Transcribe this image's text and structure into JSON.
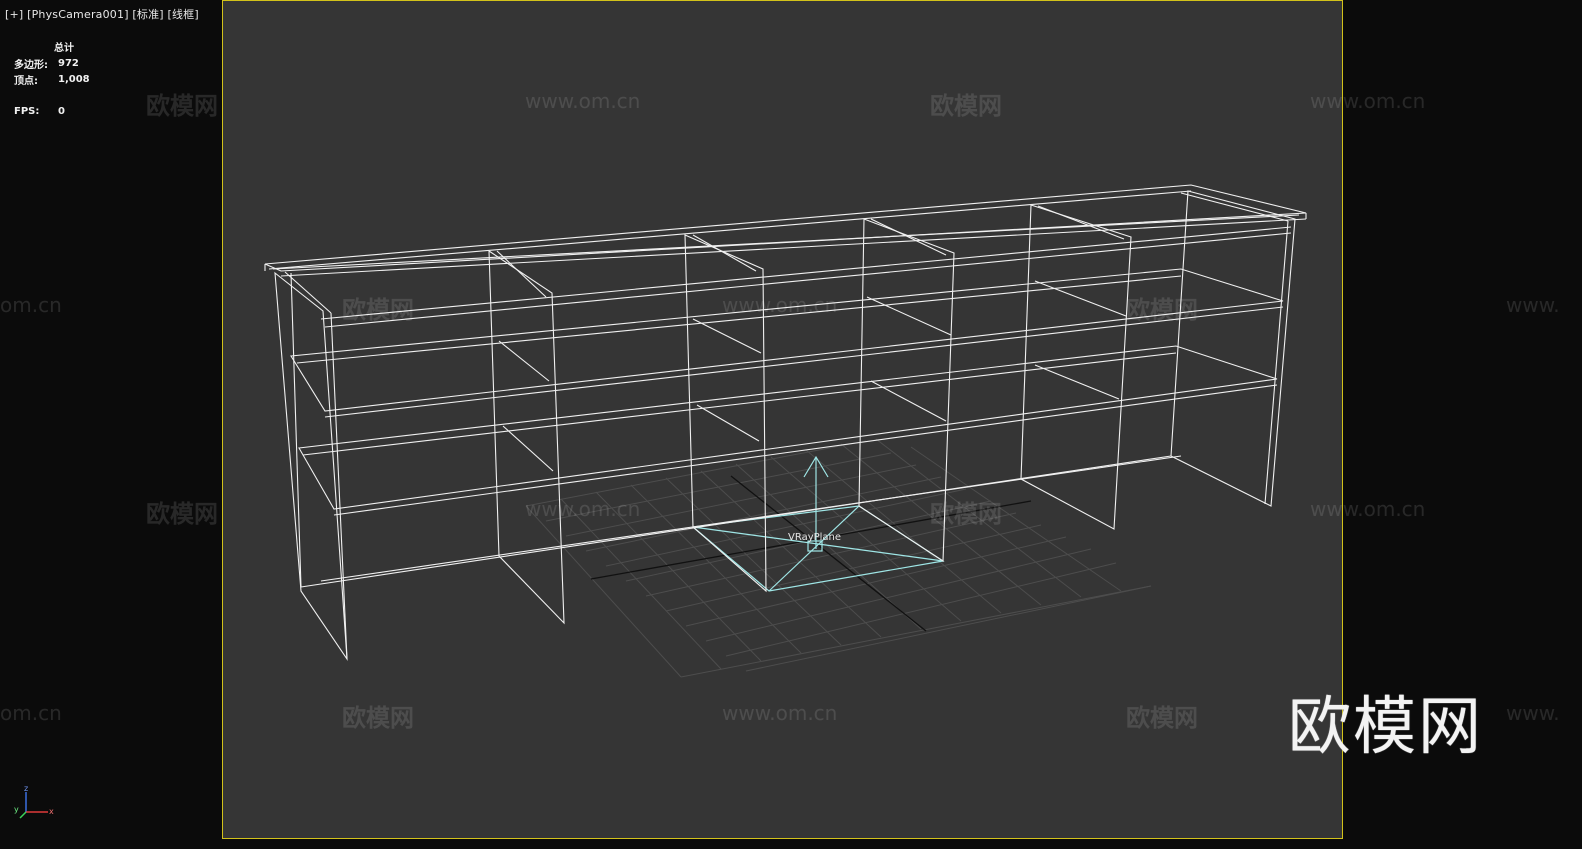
{
  "viewport": {
    "label": "[+] [PhysCamera001] [标准] [线框]",
    "border_color": "#d2c21a",
    "background": "#353535"
  },
  "stats": {
    "header": "总计",
    "polygons_label": "多边形:",
    "polygons_value": "972",
    "vertices_label": "顶点:",
    "vertices_value": "1,008",
    "fps_label": "FPS:",
    "fps_value": "0"
  },
  "scene": {
    "object_name": "VRayPlane",
    "wireframe_color": "#f0f0f0",
    "selected_color": "#9fe6e6",
    "grid_color": "#4f4f4f"
  },
  "axis_gizmo": {
    "x": "x",
    "y": "y",
    "z": "z"
  },
  "watermarks": {
    "logo_text": "欧模网",
    "url_text": "www.om.cn",
    "url_partial_left": "om.cn",
    "url_partial_right": "www."
  }
}
